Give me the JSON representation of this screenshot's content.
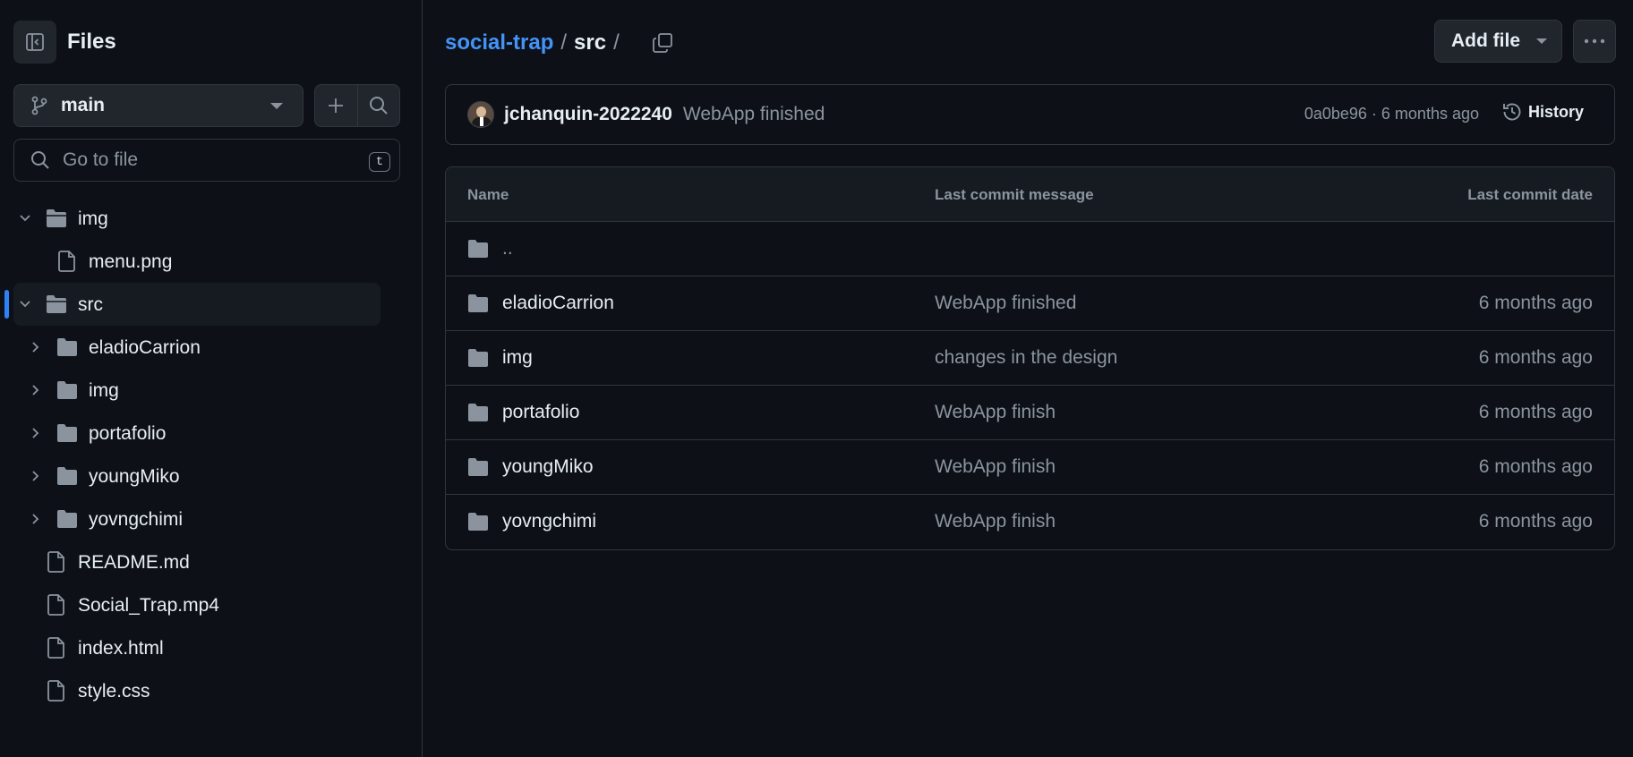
{
  "sidebar": {
    "title": "Files",
    "branch": "main",
    "search": {
      "placeholder": "Go to file",
      "shortcut": "t"
    },
    "tree": [
      {
        "label": "img",
        "type": "folder",
        "expanded": true,
        "depth": 0
      },
      {
        "label": "menu.png",
        "type": "file",
        "depth": 1
      },
      {
        "label": "src",
        "type": "folder",
        "expanded": true,
        "depth": 0,
        "active": true
      },
      {
        "label": "eladioCarrion",
        "type": "folder",
        "expanded": false,
        "depth": 1
      },
      {
        "label": "img",
        "type": "folder",
        "expanded": false,
        "depth": 1
      },
      {
        "label": "portafolio",
        "type": "folder",
        "expanded": false,
        "depth": 1
      },
      {
        "label": "youngMiko",
        "type": "folder",
        "expanded": false,
        "depth": 1
      },
      {
        "label": "yovngchimi",
        "type": "folder",
        "expanded": false,
        "depth": 1
      },
      {
        "label": "README.md",
        "type": "file",
        "depth": 0
      },
      {
        "label": "Social_Trap.mp4",
        "type": "file",
        "depth": 0
      },
      {
        "label": "index.html",
        "type": "file",
        "depth": 0
      },
      {
        "label": "style.css",
        "type": "file",
        "depth": 0
      }
    ]
  },
  "breadcrumb": {
    "repo": "social-trap",
    "separator": "/",
    "current": "src",
    "trailing": "/"
  },
  "toolbar": {
    "add_file": "Add file"
  },
  "commit": {
    "author": "jchanquin-2022240",
    "message": "WebApp finished",
    "meta": "0a0be96 · 6 months ago",
    "history": "History"
  },
  "table": {
    "headers": {
      "name": "Name",
      "message": "Last commit message",
      "date": "Last commit date"
    },
    "rows": [
      {
        "name": "..",
        "message": "",
        "date": ""
      },
      {
        "name": "eladioCarrion",
        "message": "WebApp finished",
        "date": "6 months ago"
      },
      {
        "name": "img",
        "message": "changes in the design",
        "date": "6 months ago"
      },
      {
        "name": "portafolio",
        "message": "WebApp finish",
        "date": "6 months ago"
      },
      {
        "name": "youngMiko",
        "message": "WebApp finish",
        "date": "6 months ago"
      },
      {
        "name": "yovngchimi",
        "message": "WebApp finish",
        "date": "6 months ago"
      }
    ]
  },
  "colors": {
    "background": "#0d1117",
    "link": "#4493f8",
    "border": "#30363d",
    "muted": "#8b949e",
    "active_marker": "#2f81f7"
  }
}
